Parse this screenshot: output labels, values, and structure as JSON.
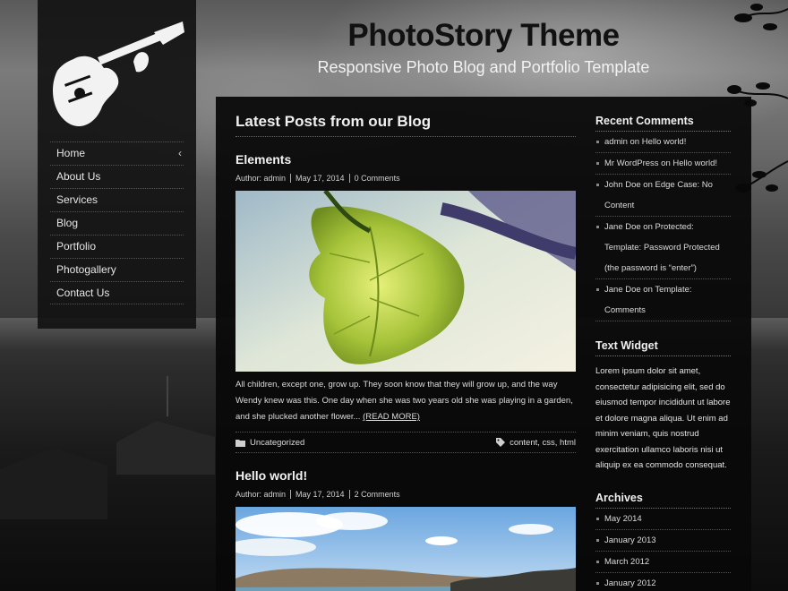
{
  "site": {
    "title": "PhotoStory Theme",
    "tagline": "Responsive Photo Blog and Portfolio Template"
  },
  "menu": [
    {
      "label": "Home"
    },
    {
      "label": "About Us"
    },
    {
      "label": "Services"
    },
    {
      "label": "Blog"
    },
    {
      "label": "Portfolio"
    },
    {
      "label": "Photogallery"
    },
    {
      "label": "Contact Us"
    }
  ],
  "main": {
    "heading": "Latest Posts from our Blog",
    "posts": [
      {
        "title": "Elements",
        "author": "Author: admin",
        "date": "May 17, 2014",
        "comments": "0 Comments",
        "excerpt": "All children, except one, grow up. They soon know that they will grow up, and the way Wendy knew was this. One day when she was two years old she was playing in a garden, and she plucked another flower... ",
        "read_more": "(READ MORE)",
        "category": "Uncategorized",
        "tags": "content, css, html"
      },
      {
        "title": "Hello world!",
        "author": "Author: admin",
        "date": "May 17, 2014",
        "comments": "2 Comments"
      }
    ]
  },
  "widgets": {
    "recent_comments": {
      "title": "Recent Comments",
      "items": [
        "admin on Hello world!",
        "Mr WordPress on Hello world!",
        "John Doe on Edge Case: No Content",
        "Jane Doe on Protected: Template: Password Protected (the password is “enter”)",
        "Jane Doe on Template: Comments"
      ]
    },
    "text_widget": {
      "title": "Text Widget",
      "body": "Lorem ipsum dolor sit amet, consectetur adipisicing elit, sed do eiusmod tempor incididunt ut labore et dolore magna aliqua. Ut enim ad minim veniam, quis nostrud exercitation ullamco laboris nisi ut aliquip ex ea commodo consequat."
    },
    "archives": {
      "title": "Archives",
      "items": [
        "May 2014",
        "January 2013",
        "March 2012",
        "January 2012"
      ]
    }
  },
  "icons": {
    "menu_expand": "chevron-left-icon",
    "category": "folder-icon",
    "tags": "tag-icon"
  }
}
